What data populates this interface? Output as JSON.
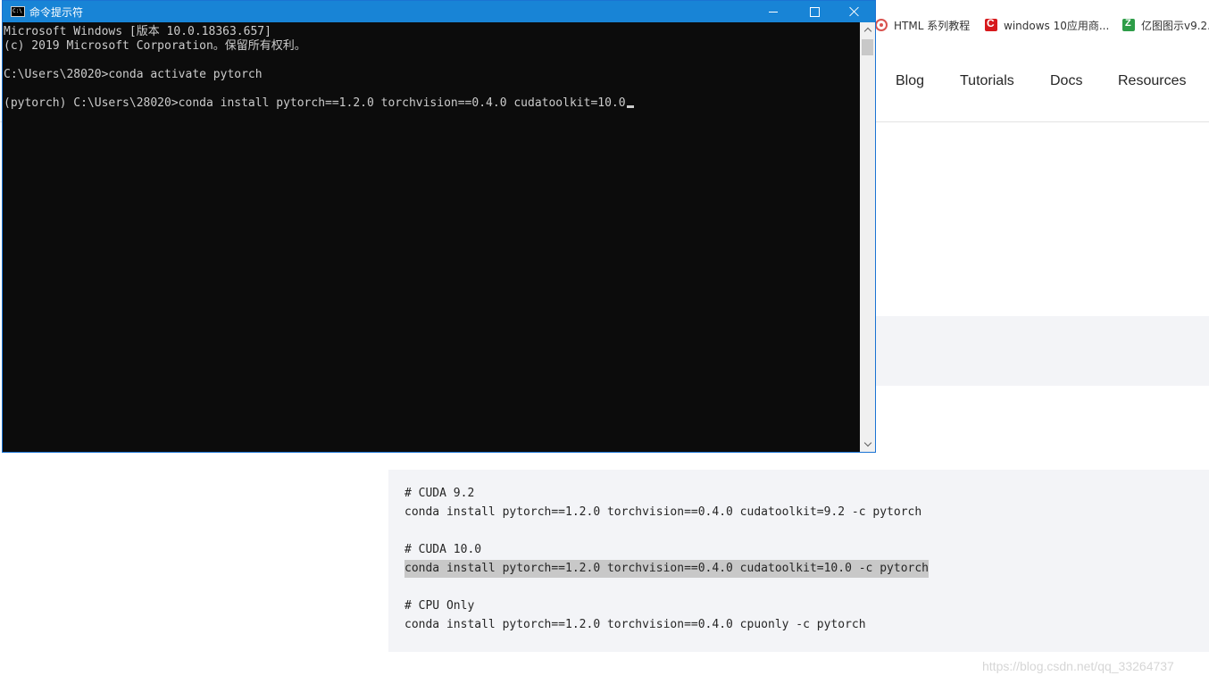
{
  "browser": {
    "bookmarks": [
      {
        "label": "HTML 系列教程",
        "icon": "html-icon"
      },
      {
        "label": "windows 10应用商...",
        "icon": "csdn-c-icon"
      },
      {
        "label": "亿图图示v9.2.",
        "icon": "edraw-z-icon"
      }
    ],
    "nav": [
      "Blog",
      "Tutorials",
      "Docs",
      "Resources"
    ],
    "code_block": [
      "# CUDA 9.2",
      "conda install pytorch==1.2.0 torchvision==0.4.0 cudatoolkit=9.2 -c pytorch",
      "",
      "# CUDA 10.0",
      "conda install pytorch==1.2.0 torchvision==0.4.0 cudatoolkit=10.0 -c pytorch",
      "",
      "# CPU Only",
      "conda install pytorch==1.2.0 torchvision==0.4.0 cpuonly -c pytorch"
    ],
    "watermark": "https://blog.csdn.net/qq_33264737"
  },
  "cmd": {
    "title": "命令提示符",
    "icon_text": "C:\\",
    "lines": [
      "Microsoft Windows [版本 10.0.18363.657]",
      "(c) 2019 Microsoft Corporation。保留所有权利。",
      "",
      "C:\\Users\\28020>conda activate pytorch",
      "",
      "(pytorch) C:\\Users\\28020>conda install pytorch==1.2.0 torchvision==0.4.0 cudatoolkit=10.0"
    ]
  },
  "colors": {
    "titlebar": "#1884d6",
    "console_bg": "#0c0c0c",
    "console_text": "#cccccc",
    "code_bg": "#f3f4f7",
    "highlight": "#c8c8c8"
  }
}
